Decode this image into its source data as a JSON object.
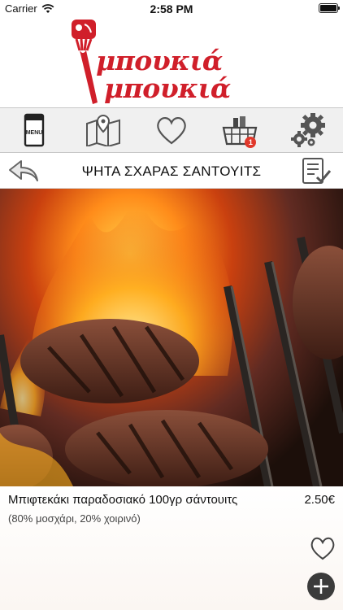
{
  "status_bar": {
    "carrier": "Carrier",
    "time": "2:58 PM"
  },
  "logo": {
    "line1": "μπουκιά",
    "line2": "μπουκιά",
    "brand_color": "#d01f2a"
  },
  "toolbar": {
    "menu_label": "MENU",
    "cart_badge": "1",
    "icons": [
      "menu-icon",
      "map-icon",
      "heart-icon",
      "basket-icon",
      "gears-icon"
    ]
  },
  "header": {
    "title": "ΨΗΤΑ ΣΧΑΡΑΣ ΣΑΝΤΟΥΙΤΣ"
  },
  "item": {
    "name": "Μπιφτεκάκι παραδοσιακό 100γρ σάντουιτς",
    "price": "2.50€",
    "description": "(80% μοσχάρι, 20% χοιρινό)"
  }
}
